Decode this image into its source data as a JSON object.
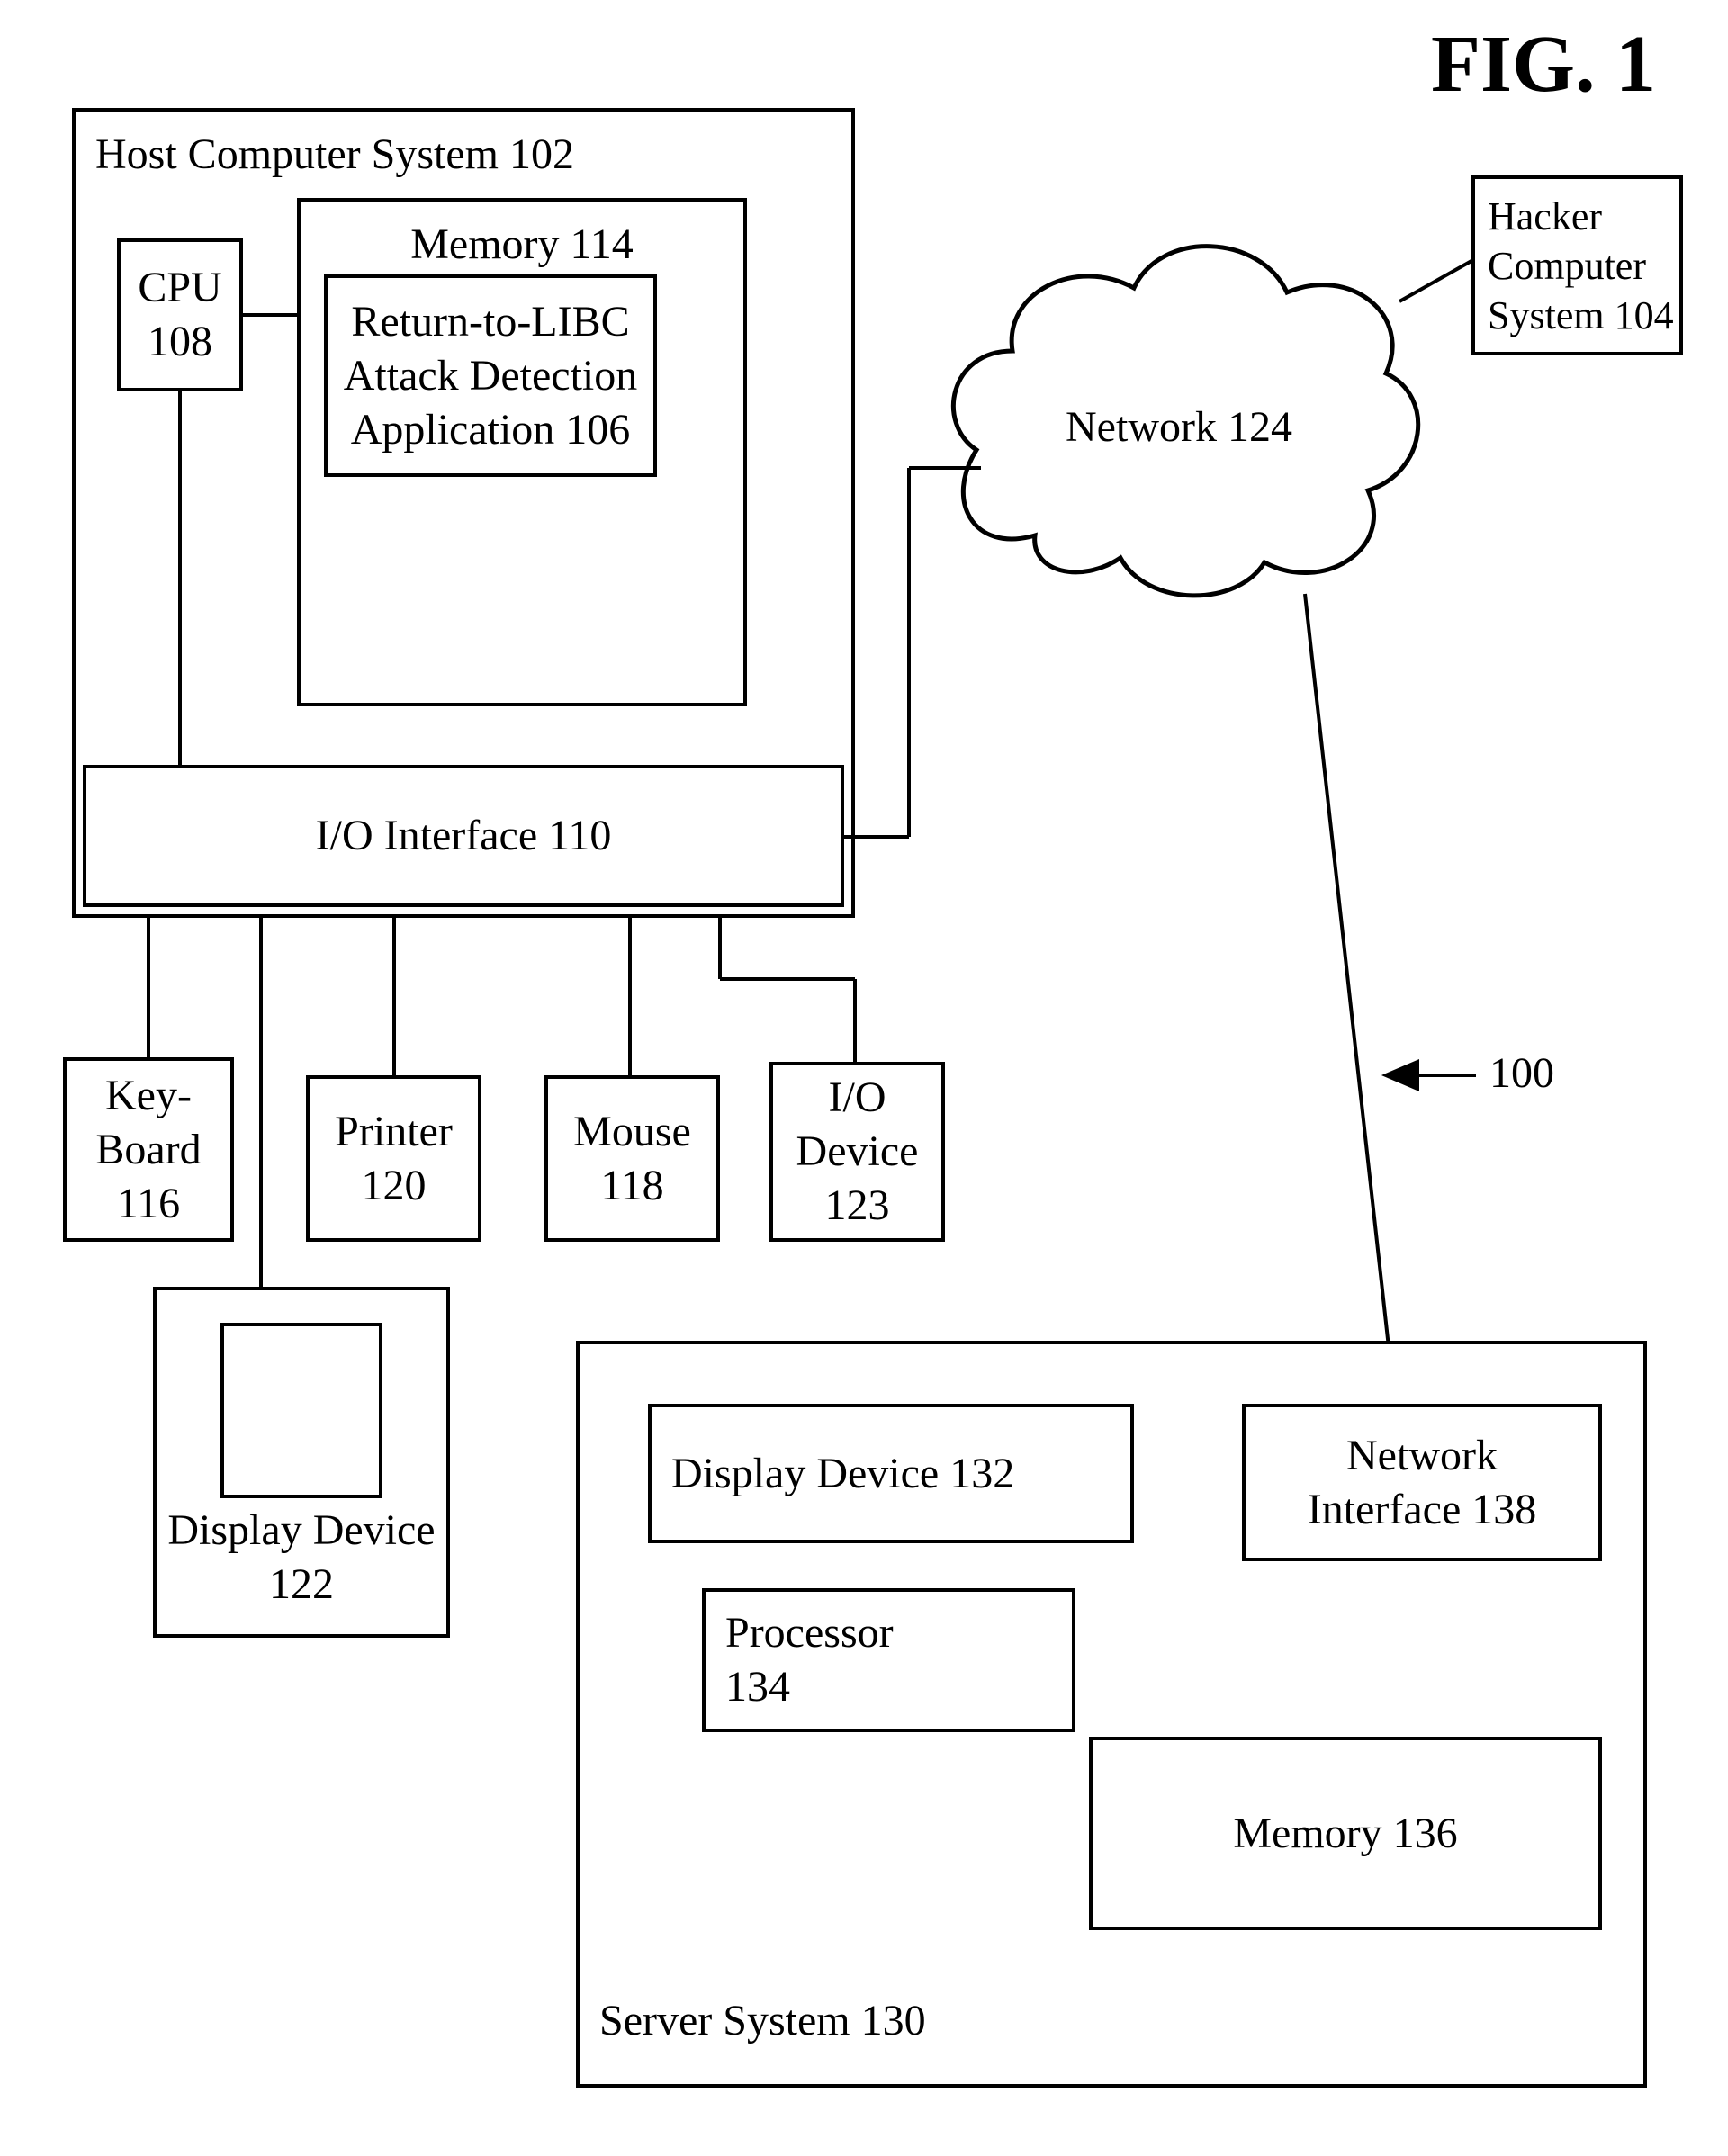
{
  "figure": {
    "title": "FIG. 1",
    "ref_label": "100"
  },
  "host": {
    "title": "Host Computer System 102",
    "cpu": "CPU\n108",
    "memory_title": "Memory 114",
    "app": "Return-to-LIBC\nAttack Detection\nApplication 106",
    "io_interface": "I/O Interface 110"
  },
  "peripherals": {
    "keyboard": "Key-\nBoard\n116",
    "printer": "Printer\n120",
    "mouse": "Mouse\n118",
    "io_device": "I/O\nDevice\n123",
    "display": "Display Device\n122"
  },
  "network": {
    "label": "Network 124"
  },
  "hacker": {
    "label": "Hacker\nComputer\nSystem 104"
  },
  "server": {
    "title": "Server System 130",
    "display": "Display Device 132",
    "processor": "Processor\n134",
    "memory": "Memory 136",
    "net_if": "Network\nInterface 138"
  }
}
